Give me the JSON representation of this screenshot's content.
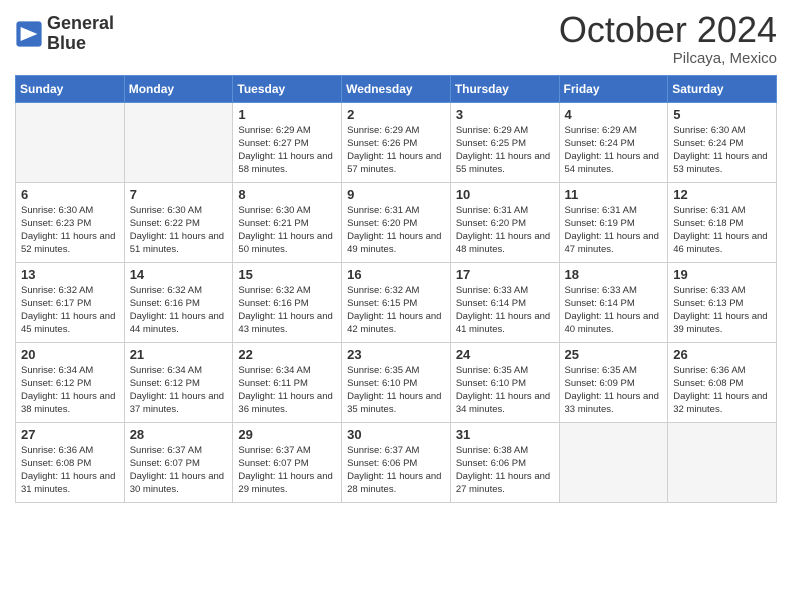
{
  "header": {
    "logo_line1": "General",
    "logo_line2": "Blue",
    "month": "October 2024",
    "location": "Pilcaya, Mexico"
  },
  "days_of_week": [
    "Sunday",
    "Monday",
    "Tuesday",
    "Wednesday",
    "Thursday",
    "Friday",
    "Saturday"
  ],
  "weeks": [
    [
      {
        "day": "",
        "info": ""
      },
      {
        "day": "",
        "info": ""
      },
      {
        "day": "1",
        "info": "Sunrise: 6:29 AM\nSunset: 6:27 PM\nDaylight: 11 hours and 58 minutes."
      },
      {
        "day": "2",
        "info": "Sunrise: 6:29 AM\nSunset: 6:26 PM\nDaylight: 11 hours and 57 minutes."
      },
      {
        "day": "3",
        "info": "Sunrise: 6:29 AM\nSunset: 6:25 PM\nDaylight: 11 hours and 55 minutes."
      },
      {
        "day": "4",
        "info": "Sunrise: 6:29 AM\nSunset: 6:24 PM\nDaylight: 11 hours and 54 minutes."
      },
      {
        "day": "5",
        "info": "Sunrise: 6:30 AM\nSunset: 6:24 PM\nDaylight: 11 hours and 53 minutes."
      }
    ],
    [
      {
        "day": "6",
        "info": "Sunrise: 6:30 AM\nSunset: 6:23 PM\nDaylight: 11 hours and 52 minutes."
      },
      {
        "day": "7",
        "info": "Sunrise: 6:30 AM\nSunset: 6:22 PM\nDaylight: 11 hours and 51 minutes."
      },
      {
        "day": "8",
        "info": "Sunrise: 6:30 AM\nSunset: 6:21 PM\nDaylight: 11 hours and 50 minutes."
      },
      {
        "day": "9",
        "info": "Sunrise: 6:31 AM\nSunset: 6:20 PM\nDaylight: 11 hours and 49 minutes."
      },
      {
        "day": "10",
        "info": "Sunrise: 6:31 AM\nSunset: 6:20 PM\nDaylight: 11 hours and 48 minutes."
      },
      {
        "day": "11",
        "info": "Sunrise: 6:31 AM\nSunset: 6:19 PM\nDaylight: 11 hours and 47 minutes."
      },
      {
        "day": "12",
        "info": "Sunrise: 6:31 AM\nSunset: 6:18 PM\nDaylight: 11 hours and 46 minutes."
      }
    ],
    [
      {
        "day": "13",
        "info": "Sunrise: 6:32 AM\nSunset: 6:17 PM\nDaylight: 11 hours and 45 minutes."
      },
      {
        "day": "14",
        "info": "Sunrise: 6:32 AM\nSunset: 6:16 PM\nDaylight: 11 hours and 44 minutes."
      },
      {
        "day": "15",
        "info": "Sunrise: 6:32 AM\nSunset: 6:16 PM\nDaylight: 11 hours and 43 minutes."
      },
      {
        "day": "16",
        "info": "Sunrise: 6:32 AM\nSunset: 6:15 PM\nDaylight: 11 hours and 42 minutes."
      },
      {
        "day": "17",
        "info": "Sunrise: 6:33 AM\nSunset: 6:14 PM\nDaylight: 11 hours and 41 minutes."
      },
      {
        "day": "18",
        "info": "Sunrise: 6:33 AM\nSunset: 6:14 PM\nDaylight: 11 hours and 40 minutes."
      },
      {
        "day": "19",
        "info": "Sunrise: 6:33 AM\nSunset: 6:13 PM\nDaylight: 11 hours and 39 minutes."
      }
    ],
    [
      {
        "day": "20",
        "info": "Sunrise: 6:34 AM\nSunset: 6:12 PM\nDaylight: 11 hours and 38 minutes."
      },
      {
        "day": "21",
        "info": "Sunrise: 6:34 AM\nSunset: 6:12 PM\nDaylight: 11 hours and 37 minutes."
      },
      {
        "day": "22",
        "info": "Sunrise: 6:34 AM\nSunset: 6:11 PM\nDaylight: 11 hours and 36 minutes."
      },
      {
        "day": "23",
        "info": "Sunrise: 6:35 AM\nSunset: 6:10 PM\nDaylight: 11 hours and 35 minutes."
      },
      {
        "day": "24",
        "info": "Sunrise: 6:35 AM\nSunset: 6:10 PM\nDaylight: 11 hours and 34 minutes."
      },
      {
        "day": "25",
        "info": "Sunrise: 6:35 AM\nSunset: 6:09 PM\nDaylight: 11 hours and 33 minutes."
      },
      {
        "day": "26",
        "info": "Sunrise: 6:36 AM\nSunset: 6:08 PM\nDaylight: 11 hours and 32 minutes."
      }
    ],
    [
      {
        "day": "27",
        "info": "Sunrise: 6:36 AM\nSunset: 6:08 PM\nDaylight: 11 hours and 31 minutes."
      },
      {
        "day": "28",
        "info": "Sunrise: 6:37 AM\nSunset: 6:07 PM\nDaylight: 11 hours and 30 minutes."
      },
      {
        "day": "29",
        "info": "Sunrise: 6:37 AM\nSunset: 6:07 PM\nDaylight: 11 hours and 29 minutes."
      },
      {
        "day": "30",
        "info": "Sunrise: 6:37 AM\nSunset: 6:06 PM\nDaylight: 11 hours and 28 minutes."
      },
      {
        "day": "31",
        "info": "Sunrise: 6:38 AM\nSunset: 6:06 PM\nDaylight: 11 hours and 27 minutes."
      },
      {
        "day": "",
        "info": ""
      },
      {
        "day": "",
        "info": ""
      }
    ]
  ]
}
